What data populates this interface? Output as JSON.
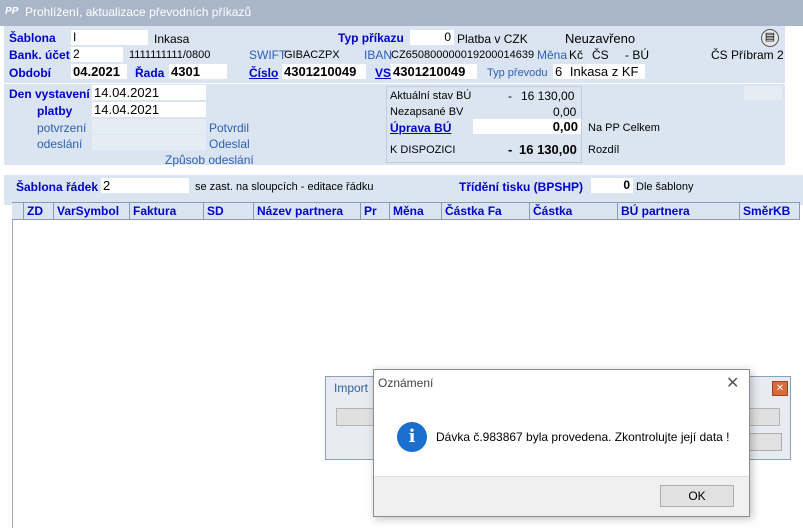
{
  "window": {
    "title": "Prohlížení, aktualizace převodních příkazů",
    "icon_text": "PP"
  },
  "header": {
    "sablona_label": "Šablona",
    "sablona_value": "I",
    "sablona_name": "Inkasa",
    "typ_prikazu_label": "Typ příkazu",
    "typ_prikazu_value": "0",
    "typ_prikazu_text": "Platba v CZK",
    "stav": "Neuzavřeno",
    "bank_ucet_label": "Bank. účet",
    "bank_ucet_value": "2",
    "bank_ucet_number": "1111111111/0800",
    "swift_label": "SWIFT",
    "swift_value": "GIBACZPX",
    "iban_label": "IBAN",
    "iban_value": "CZ650800000019200014639",
    "mena_label": "Měna",
    "mena_value": "Kč",
    "bank_short": "ČS",
    "bu_text": "- BÚ",
    "branch": "ČS Příbram 2",
    "obdobi_label": "Období",
    "obdobi_value": "04.2021",
    "rada_label": "Řada",
    "rada_value": "4301",
    "cislo_label": "Číslo",
    "cislo_value": "4301210049",
    "vs_label": "VS",
    "vs_value": "4301210049",
    "typ_prevodu_label": "Typ převodu",
    "typ_prevodu_value": "6",
    "typ_prevodu_text": "Inkasa z KF"
  },
  "dates": {
    "den_vystaveni_label": "Den vystavení",
    "den_vystaveni_value": "14.04.2021",
    "platby_label": "platby",
    "platby_value": "14.04.2021",
    "potvrzeni_label": "potvrzení",
    "potvrdil_label": "Potvrdil",
    "odeslani_label": "odeslání",
    "odeslal_label": "Odeslal",
    "zpusob_label": "Způsob odeslání"
  },
  "balances": {
    "aktualni_label": "Aktuální stav BÚ",
    "aktualni_sign": "-",
    "aktualni_value": "16 130,00",
    "nezapsane_label": "Nezapsané BV",
    "nezapsane_value": "0,00",
    "uprava_label": "Úprava BÚ",
    "uprava_value": "0,00",
    "na_pp_label": "Na PP Celkem",
    "k_dispozici_label": "K DISPOZICI",
    "k_dispozici_sign": "-",
    "k_dispozici_value": "16 130,00",
    "rozdil_label": "Rozdíl"
  },
  "grid": {
    "sablona_radek_label": "Šablona řádek",
    "sablona_radek_value": "2",
    "sablona_radek_note": "se zast. na sloupcích - editace řádku",
    "trideni_label": "Třídění tisku (BPSHP)",
    "trideni_value": "0",
    "trideni_text": "Dle šablony",
    "columns": [
      "ZD",
      "VarSymbol",
      "Faktura",
      "SD",
      "Název partnera",
      "Pr",
      "Měna",
      "Částka Fa",
      "Částka",
      "BÚ partnera",
      "SměrKB"
    ]
  },
  "bg_dialog": {
    "title": "Import"
  },
  "modal": {
    "title": "Oznámení",
    "message": "Dávka č.983867 byla provedena.  Zkontrolujte její data !",
    "ok_label": "OK",
    "close_glyph": "✕",
    "icon": "info-icon"
  },
  "colors": {
    "panel": "#dbe5f1",
    "label_blue": "#0000cc",
    "titlebar": "#a9b5c9",
    "info": "#1a6fcc"
  }
}
